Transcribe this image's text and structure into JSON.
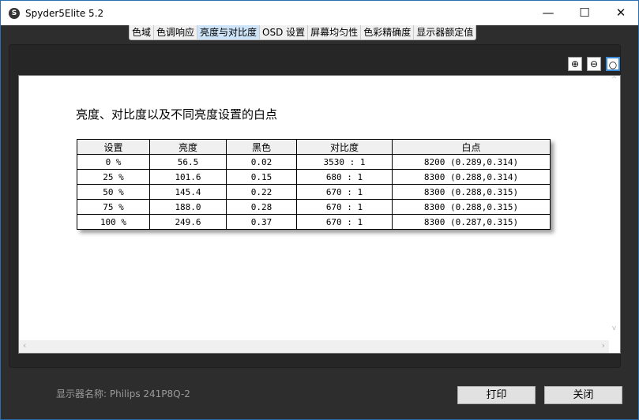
{
  "window": {
    "title": "Spyder5Elite 5.2",
    "minimize": "—",
    "maximize": "☐",
    "close": "✕"
  },
  "tabs": [
    {
      "label": "色域"
    },
    {
      "label": "色调响应"
    },
    {
      "label": "亮度与对比度",
      "active": true
    },
    {
      "label": "OSD 设置"
    },
    {
      "label": "屏幕均匀性"
    },
    {
      "label": "色彩精确度"
    },
    {
      "label": "显示器额定值"
    }
  ],
  "report": {
    "heading": "亮度、对比度以及不同亮度设置的白点",
    "columns": [
      "设置",
      "亮度",
      "黑色",
      "对比度",
      "白点"
    ],
    "rows": [
      [
        "0 %",
        "56.5",
        "0.02",
        "3530 : 1",
        "8200 (0.289,0.314)"
      ],
      [
        "25 %",
        "101.6",
        "0.15",
        "680 : 1",
        "8300 (0.288,0.314)"
      ],
      [
        "50 %",
        "145.4",
        "0.22",
        "670 : 1",
        "8300 (0.288,0.315)"
      ],
      [
        "75 %",
        "188.0",
        "0.28",
        "670 : 1",
        "8300 (0.288,0.315)"
      ],
      [
        "100 %",
        "249.6",
        "0.37",
        "670 : 1",
        "8300 (0.287,0.315)"
      ]
    ]
  },
  "footer": {
    "monitor_label": "显示器名称: Philips 241P8Q-2",
    "print": "打印",
    "close": "关闭"
  }
}
